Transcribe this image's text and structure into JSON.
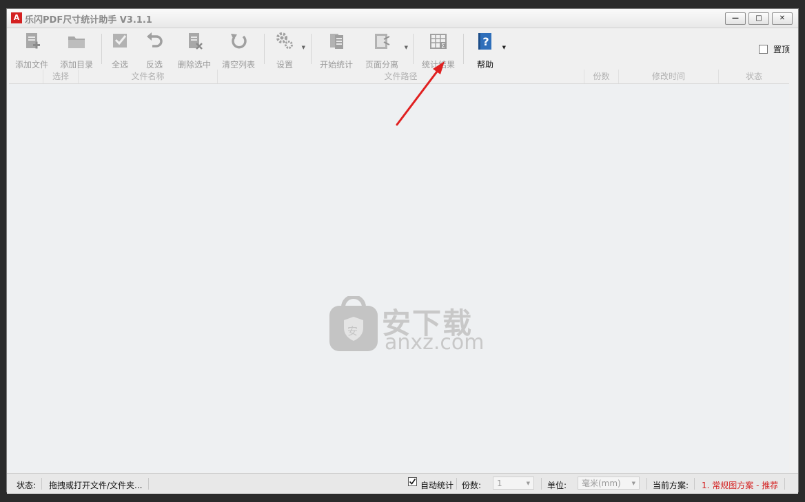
{
  "window": {
    "title": "乐闪PDF尺寸统计助手 V3.1.1",
    "app_icon_glyph": "A",
    "controls": {
      "minimize": "—",
      "maximize": "□",
      "close": "✕"
    }
  },
  "toolbar": {
    "add_file": "添加文件",
    "add_folder": "添加目录",
    "select_all": "全选",
    "invert": "反选",
    "delete_selected": "删除选中",
    "clear_list": "清空列表",
    "settings": "设置",
    "start_stats": "开始统计",
    "page_split": "页面分离",
    "stats_result": "统计结果",
    "help": "帮助",
    "pin_top": "置顶"
  },
  "table": {
    "columns": [
      "选择",
      "文件名称",
      "文件路径",
      "份数",
      "修改时间",
      "状态"
    ]
  },
  "watermark": {
    "cn": "安下载",
    "en": "anxz.com",
    "badge": "安"
  },
  "statusbar": {
    "status_label": "状态:",
    "status_text": "拖拽或打开文件/文件夹...",
    "auto_stats": "自动统计",
    "copies_label": "份数:",
    "copies_value": "1",
    "unit_label": "单位:",
    "unit_value": "毫米(mm)",
    "scheme_label": "当前方案:",
    "scheme_value": "1. 常规图方案 - 推荐"
  },
  "colors": {
    "accent_red": "#d42020",
    "help_blue": "#2f6fba",
    "annotation_arrow": "#e02020"
  }
}
